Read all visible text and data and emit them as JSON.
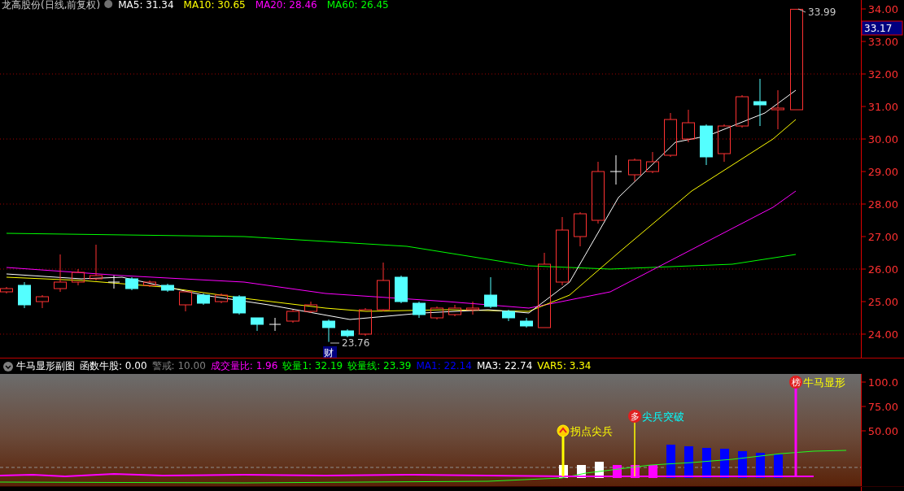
{
  "chart_header": {
    "title": "龙高股份(日线,前复权)",
    "indicators": [
      {
        "label": "MA5: 31.34",
        "color": "#ffffff"
      },
      {
        "label": "MA10: 30.65",
        "color": "#ffff00"
      },
      {
        "label": "MA20: 28.46",
        "color": "#ff00ff"
      },
      {
        "label": "MA60: 26.45",
        "color": "#00ff00"
      }
    ]
  },
  "price_axis": {
    "ticks": [
      "34.00",
      "33.00",
      "32.00",
      "31.00",
      "30.00",
      "29.00",
      "28.00",
      "27.00",
      "26.00",
      "25.00",
      "24.00"
    ],
    "current_price": "33.17"
  },
  "annotations": [
    {
      "kind": "high",
      "text": "33.99"
    },
    {
      "kind": "low",
      "text": "23.76"
    }
  ],
  "marker": {
    "text": "财"
  },
  "indicator_legend": {
    "title": "牛马显形副图",
    "items": [
      {
        "label": "函数牛股: 0.00",
        "color": "#ffffff"
      },
      {
        "label": "警戒: 10.00",
        "color": "#808080"
      },
      {
        "label": "成交量比: 1.96",
        "color": "#ff00ff"
      },
      {
        "label": "较量1: 32.19",
        "color": "#00ff00"
      },
      {
        "label": "较量线: 23.39",
        "color": "#00ff00"
      },
      {
        "label": "MA1: 22.14",
        "color": "#0000ff"
      },
      {
        "label": "MA3: 22.74",
        "color": "#ffffff"
      },
      {
        "label": "VAR5: 3.34",
        "color": "#ffff00"
      }
    ]
  },
  "sub_axis": {
    "ticks": [
      "100.0",
      "75.00",
      "50.00"
    ]
  },
  "signals": [
    {
      "kind": "chevron",
      "label": "拐点尖兵",
      "color": "#ffff00"
    },
    {
      "kind": "badge",
      "badge": "多",
      "label": "尖兵突破",
      "color": "#00ffff"
    },
    {
      "kind": "badge",
      "badge": "榜",
      "label": "牛马显形",
      "color": "#ffff00"
    }
  ]
}
